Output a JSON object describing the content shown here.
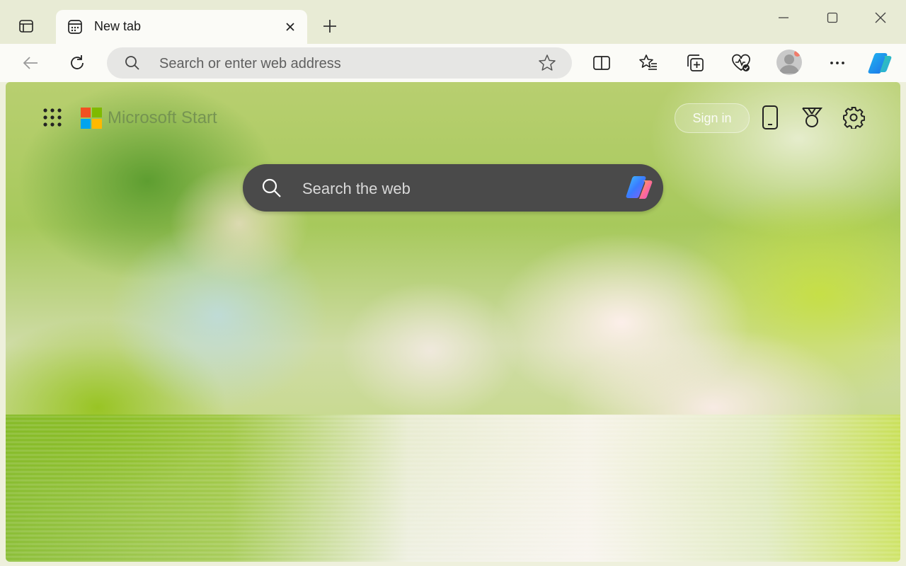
{
  "tab": {
    "title": "New tab"
  },
  "address_bar": {
    "placeholder": "Search or enter web address"
  },
  "newtab_page": {
    "brand": "Microsoft Start",
    "sign_in_label": "Sign in",
    "search_placeholder": "Search the web"
  },
  "colors": {
    "ms_red": "#f25022",
    "ms_green": "#7fba00",
    "ms_blue": "#00a4ef",
    "ms_yellow": "#ffb900"
  },
  "icons": {
    "toolbar": [
      "back-icon",
      "refresh-icon",
      "search-icon",
      "favorite-star-icon",
      "split-screen-icon",
      "favorites-icon",
      "collections-icon",
      "browser-essentials-icon",
      "profile-avatar-icon",
      "more-icon",
      "copilot-icon"
    ],
    "page_header": [
      "apps-grid-icon",
      "phone-icon",
      "rewards-icon",
      "settings-icon"
    ]
  }
}
